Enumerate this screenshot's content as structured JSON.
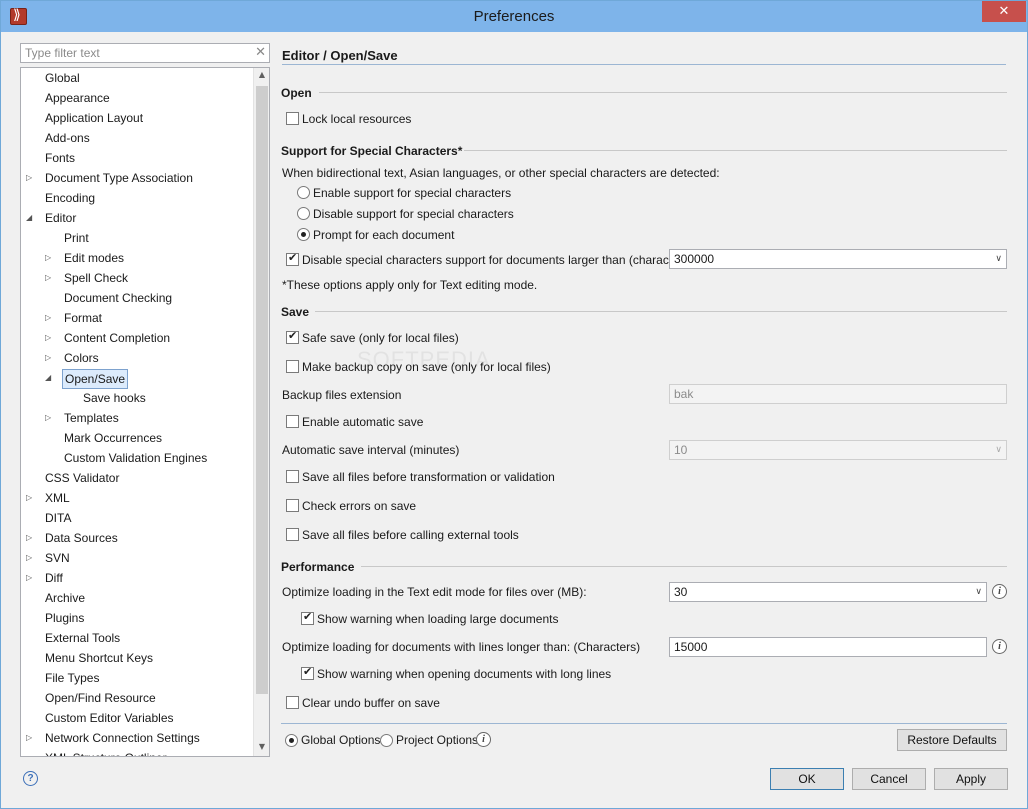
{
  "window": {
    "title": "Preferences",
    "close_glyph": "✕"
  },
  "filter": {
    "placeholder": "Type filter text",
    "clear_glyph": "✕"
  },
  "tree": [
    {
      "label": "Global",
      "level": 0,
      "toggle": ""
    },
    {
      "label": "Appearance",
      "level": 0,
      "toggle": ""
    },
    {
      "label": "Application Layout",
      "level": 0,
      "toggle": ""
    },
    {
      "label": "Add-ons",
      "level": 0,
      "toggle": ""
    },
    {
      "label": "Fonts",
      "level": 0,
      "toggle": ""
    },
    {
      "label": "Document Type Association",
      "level": 0,
      "toggle": "▷"
    },
    {
      "label": "Encoding",
      "level": 0,
      "toggle": ""
    },
    {
      "label": "Editor",
      "level": 0,
      "toggle": "◢"
    },
    {
      "label": "Print",
      "level": 1,
      "toggle": ""
    },
    {
      "label": "Edit modes",
      "level": 1,
      "toggle": "▷"
    },
    {
      "label": "Spell Check",
      "level": 1,
      "toggle": "▷"
    },
    {
      "label": "Document Checking",
      "level": 1,
      "toggle": ""
    },
    {
      "label": "Format",
      "level": 1,
      "toggle": "▷"
    },
    {
      "label": "Content Completion",
      "level": 1,
      "toggle": "▷"
    },
    {
      "label": "Colors",
      "level": 1,
      "toggle": "▷"
    },
    {
      "label": "Open/Save",
      "level": 1,
      "toggle": "◢",
      "selected": true
    },
    {
      "label": "Save hooks",
      "level": 2,
      "toggle": ""
    },
    {
      "label": "Templates",
      "level": 1,
      "toggle": "▷"
    },
    {
      "label": "Mark Occurrences",
      "level": 1,
      "toggle": ""
    },
    {
      "label": "Custom Validation Engines",
      "level": 1,
      "toggle": ""
    },
    {
      "label": "CSS Validator",
      "level": 0,
      "toggle": ""
    },
    {
      "label": "XML",
      "level": 0,
      "toggle": "▷"
    },
    {
      "label": "DITA",
      "level": 0,
      "toggle": ""
    },
    {
      "label": "Data Sources",
      "level": 0,
      "toggle": "▷"
    },
    {
      "label": "SVN",
      "level": 0,
      "toggle": "▷"
    },
    {
      "label": "Diff",
      "level": 0,
      "toggle": "▷"
    },
    {
      "label": "Archive",
      "level": 0,
      "toggle": ""
    },
    {
      "label": "Plugins",
      "level": 0,
      "toggle": ""
    },
    {
      "label": "External Tools",
      "level": 0,
      "toggle": ""
    },
    {
      "label": "Menu Shortcut Keys",
      "level": 0,
      "toggle": ""
    },
    {
      "label": "File Types",
      "level": 0,
      "toggle": ""
    },
    {
      "label": "Open/Find Resource",
      "level": 0,
      "toggle": ""
    },
    {
      "label": "Custom Editor Variables",
      "level": 0,
      "toggle": ""
    },
    {
      "label": "Network Connection Settings",
      "level": 0,
      "toggle": "▷"
    },
    {
      "label": "XML Structure Outliner",
      "level": 0,
      "toggle": ""
    }
  ],
  "scroll": {
    "up": "▲",
    "down": "▼"
  },
  "page": {
    "title": "Editor / Open/Save",
    "watermark": "SOFTPEDIA"
  },
  "open": {
    "heading": "Open",
    "lock_local": "Lock local resources"
  },
  "special": {
    "heading": "Support for Special Characters*",
    "intro": "When bidirectional text, Asian languages, or other special characters are detected:",
    "opt_enable": "Enable support for special characters",
    "opt_disable": "Disable support for special characters",
    "opt_prompt": "Prompt for each document",
    "disable_large": "Disable special characters support for documents larger than (characters):",
    "disable_large_value": "300000",
    "note": "*These options apply only for Text editing mode."
  },
  "save": {
    "heading": "Save",
    "safe_save": "Safe save (only for local files)",
    "backup_copy": "Make backup copy on save (only for local files)",
    "backup_ext_label": "Backup files extension",
    "backup_ext_value": "bak",
    "auto_save": "Enable automatic save",
    "interval_label": "Automatic save interval (minutes)",
    "interval_value": "10",
    "save_before_transform": "Save all files before transformation or validation",
    "check_errors": "Check errors on save",
    "save_before_tools": "Save all files before calling external tools"
  },
  "performance": {
    "heading": "Performance",
    "optimize_text_label": "Optimize loading in the Text edit mode for files over (MB):",
    "optimize_text_value": "30",
    "warn_large": "Show warning when loading large documents",
    "optimize_lines_label": "Optimize loading for documents with lines longer than: (Characters)",
    "optimize_lines_value": "15000",
    "warn_long_lines": "Show warning when opening documents with long lines",
    "clear_undo": "Clear undo buffer on save"
  },
  "scope": {
    "global": "Global Options",
    "project": "Project Options"
  },
  "buttons": {
    "restore": "Restore Defaults",
    "ok": "OK",
    "cancel": "Cancel",
    "apply": "Apply"
  },
  "icons": {
    "info": "i",
    "help": "?",
    "dropdown": "∨"
  }
}
